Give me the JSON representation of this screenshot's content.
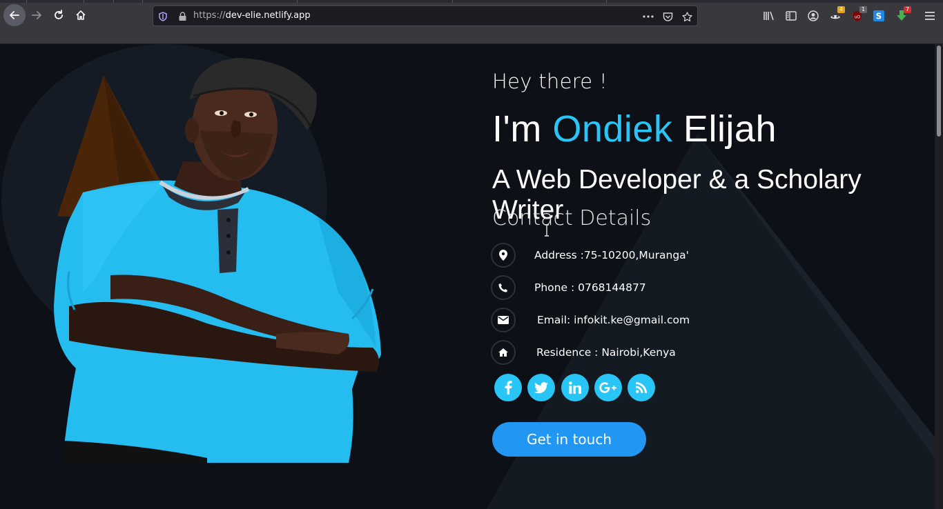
{
  "browser": {
    "url_scheme": "https://",
    "url_host": "dev-elie.netlify.app",
    "extension_badges": {
      "ext1": "4",
      "ublock": "1",
      "downloads": "7"
    }
  },
  "hero": {
    "greeting": "Hey there !",
    "name_prefix": "I'm ",
    "first_name": "Ondiek",
    "last_name": " Elijah",
    "tagline": "A Web Developer & a Scholary Writer",
    "contact_heading": "Contact Details"
  },
  "contacts": [
    {
      "icon": "map-marker-icon",
      "text": "Address :75-10200,Muranga'"
    },
    {
      "icon": "phone-icon",
      "text": "Phone : 0768144877"
    },
    {
      "icon": "envelope-icon",
      "text": "Email: infokit.ke@gmail.com"
    },
    {
      "icon": "home-icon",
      "text": "Residence : Nairobi,Kenya"
    }
  ],
  "social": [
    {
      "name": "facebook",
      "glyph": "f"
    },
    {
      "name": "twitter",
      "glyph": "t"
    },
    {
      "name": "linkedin",
      "glyph": "in"
    },
    {
      "name": "google-plus",
      "glyph": "G+"
    },
    {
      "name": "rss",
      "glyph": "rss"
    }
  ],
  "cta": {
    "label": "Get in touch"
  },
  "colors": {
    "accent": "#29c5f6",
    "button": "#2196f3",
    "background": "#0d1117",
    "shirt": "#25bcf0"
  }
}
